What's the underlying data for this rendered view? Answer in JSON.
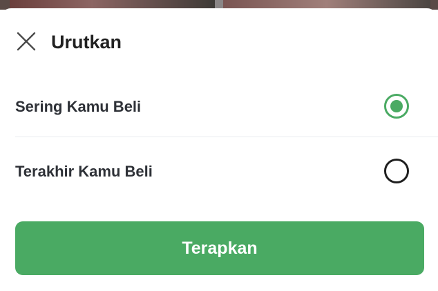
{
  "sheet": {
    "title": "Urutkan",
    "close_icon": "close-icon"
  },
  "sort_options": [
    {
      "label": "Sering Kamu Beli",
      "selected": true
    },
    {
      "label": "Terakhir Kamu Beli",
      "selected": false
    }
  ],
  "apply_button": {
    "label": "Terapkan"
  },
  "colors": {
    "accent": "#4aaa63",
    "text": "#2e3137"
  }
}
